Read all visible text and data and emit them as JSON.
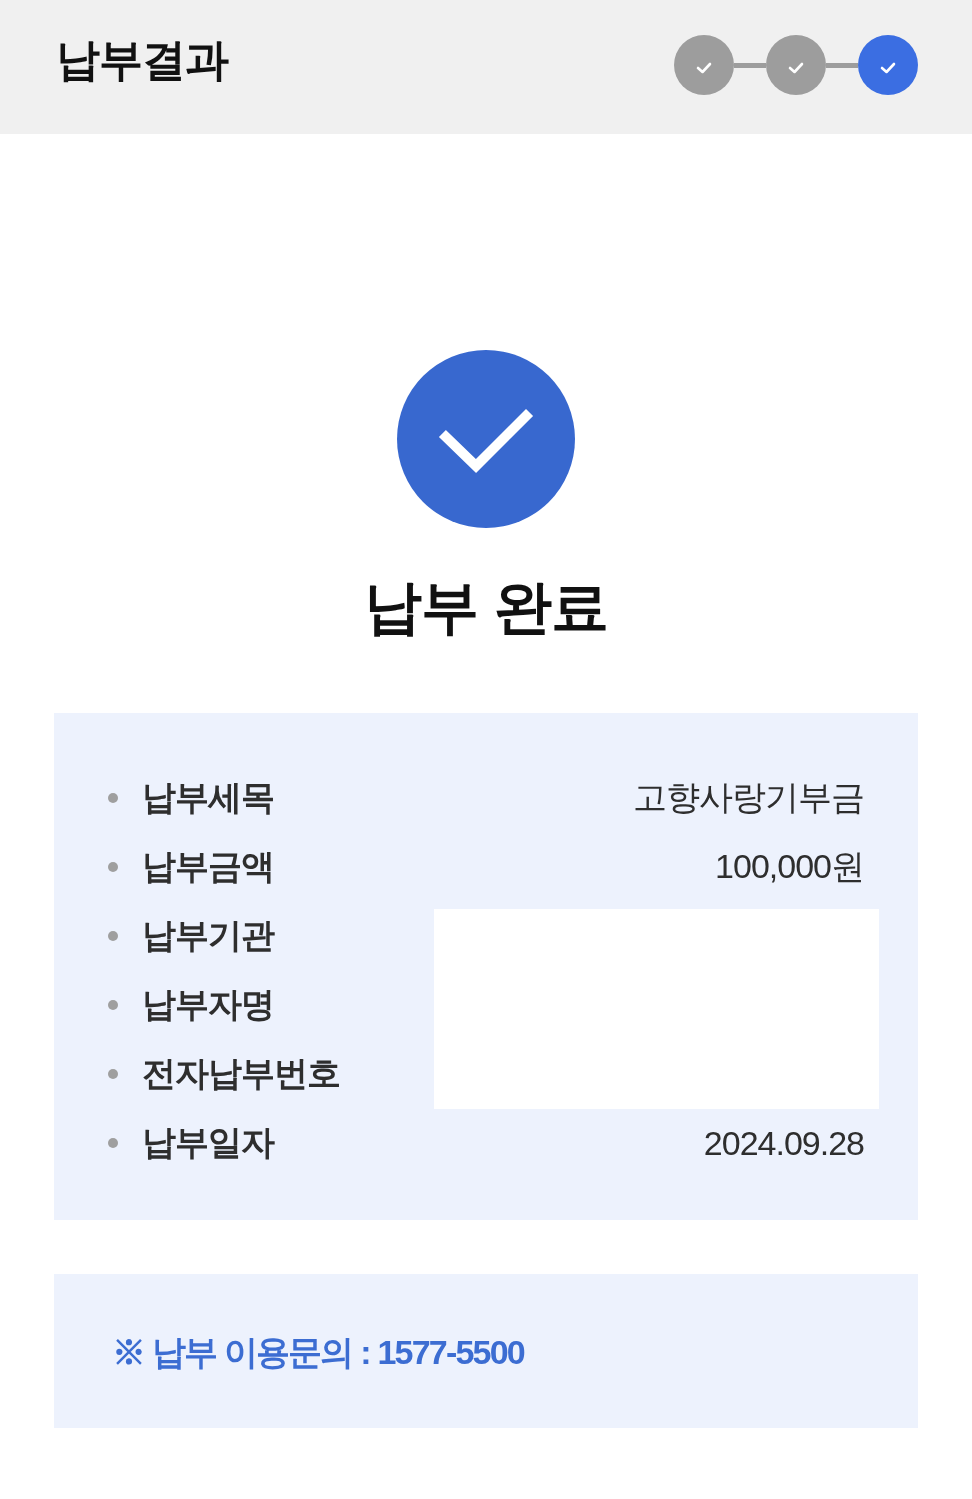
{
  "header": {
    "title": "납부결과",
    "steps": [
      {
        "selected": false
      },
      {
        "selected": false
      },
      {
        "selected": true
      }
    ]
  },
  "result": {
    "title": "납부 완료"
  },
  "details": {
    "rows": [
      {
        "label": "납부세목",
        "value": "고향사랑기부금",
        "redacted": false
      },
      {
        "label": "납부금액",
        "value": "100,000원",
        "redacted": false
      },
      {
        "label": "납부기관",
        "redacted": true
      },
      {
        "label": "납부자명",
        "redacted": true
      },
      {
        "label": "전자납부번호",
        "redacted": true
      },
      {
        "label": "납부일자",
        "value": "2024.09.28",
        "redacted": false
      }
    ]
  },
  "notice": {
    "text": "※ 납부 이용문의 : 1577-5500"
  }
}
